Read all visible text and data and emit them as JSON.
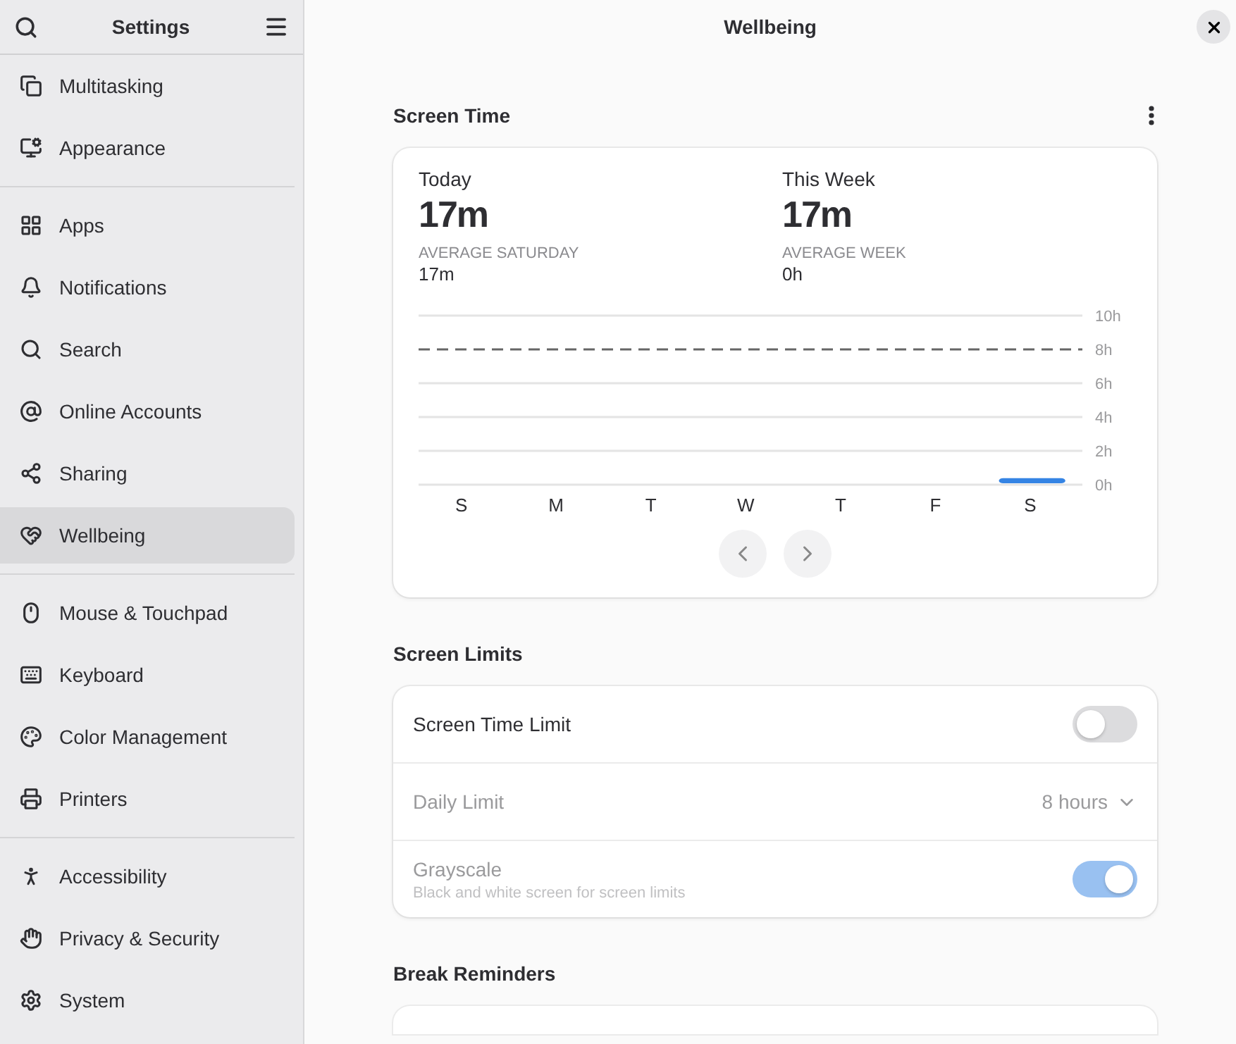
{
  "sidebar": {
    "title": "Settings",
    "groups": [
      {
        "items": [
          {
            "label": "Multitasking",
            "selected": false
          },
          {
            "label": "Appearance",
            "selected": false
          }
        ]
      },
      {
        "items": [
          {
            "label": "Apps",
            "selected": false
          },
          {
            "label": "Notifications",
            "selected": false
          },
          {
            "label": "Search",
            "selected": false
          },
          {
            "label": "Online Accounts",
            "selected": false
          },
          {
            "label": "Sharing",
            "selected": false
          },
          {
            "label": "Wellbeing",
            "selected": true
          }
        ]
      },
      {
        "items": [
          {
            "label": "Mouse & Touchpad",
            "selected": false
          },
          {
            "label": "Keyboard",
            "selected": false
          },
          {
            "label": "Color Management",
            "selected": false
          },
          {
            "label": "Printers",
            "selected": false
          }
        ]
      },
      {
        "items": [
          {
            "label": "Accessibility",
            "selected": false
          },
          {
            "label": "Privacy & Security",
            "selected": false
          },
          {
            "label": "System",
            "selected": false
          }
        ]
      }
    ]
  },
  "window": {
    "title": "Wellbeing"
  },
  "screen_time": {
    "title": "Screen Time",
    "stats": [
      {
        "label": "Today",
        "value": "17m",
        "average_label": "AVERAGE SATURDAY",
        "average": "17m"
      },
      {
        "label": "This Week",
        "value": "17m",
        "average_label": "AVERAGE WEEK",
        "average": "0h"
      }
    ],
    "chart_data": {
      "type": "bar",
      "categories": [
        "S",
        "M",
        "T",
        "W",
        "T",
        "F",
        "S"
      ],
      "values": [
        0,
        0,
        0,
        0,
        0,
        0,
        0.3
      ],
      "ylim": [
        0,
        10
      ],
      "yticks": [
        {
          "value": 0,
          "label": "0h"
        },
        {
          "value": 2,
          "label": "2h"
        },
        {
          "value": 4,
          "label": "4h"
        },
        {
          "value": 6,
          "label": "6h"
        },
        {
          "value": 8,
          "label": "8h"
        },
        {
          "value": 10,
          "label": "10h"
        }
      ],
      "grid": true,
      "ref_lines": [
        {
          "axis": "y",
          "value": 8
        }
      ]
    }
  },
  "screen_limits": {
    "title": "Screen Limits",
    "rows": [
      {
        "kind": "switch",
        "label": "Screen Time Limit",
        "on": false,
        "disabled": false
      },
      {
        "kind": "dropdown",
        "label": "Daily Limit",
        "value": "8 hours",
        "disabled": true
      },
      {
        "kind": "switch",
        "label": "Grayscale",
        "subtitle": "Black and white screen for screen limits",
        "on": true,
        "disabled": true
      }
    ]
  },
  "break_reminders": {
    "title": "Break Reminders"
  }
}
